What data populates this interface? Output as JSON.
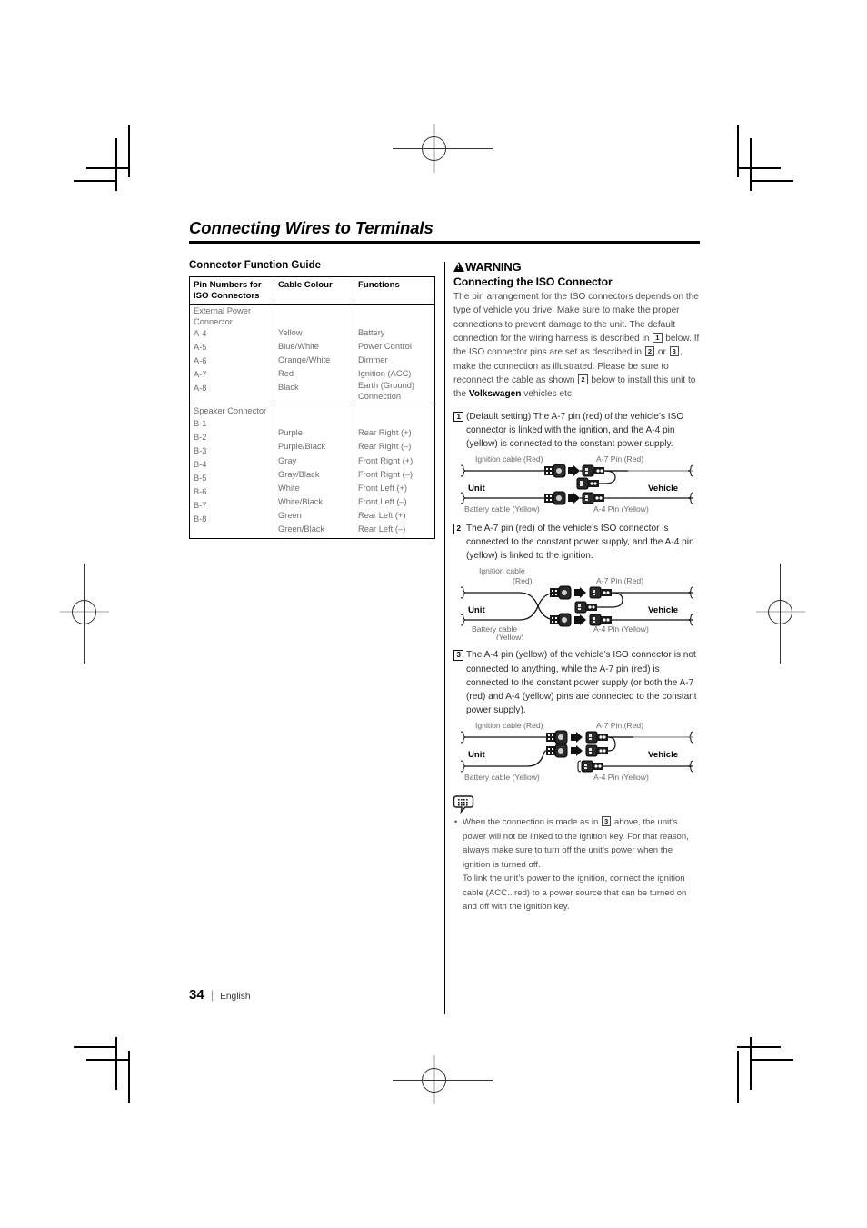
{
  "page": {
    "chapter_title": "Connecting Wires to Terminals",
    "page_number": "34",
    "separator": "|",
    "language": "English"
  },
  "left_column": {
    "section_heading": "Connector Function Guide",
    "table": {
      "headers": [
        "Pin Numbers for ISO Connectors",
        "Cable Colour",
        "Functions"
      ],
      "groups": [
        {
          "label": "External Power Connector",
          "rows": [
            {
              "pin": "A-4",
              "colour": "Yellow",
              "function": "Battery"
            },
            {
              "pin": "A-5",
              "colour": "Blue/White",
              "function": "Power Control"
            },
            {
              "pin": "A-6",
              "colour": "Orange/White",
              "function": "Dimmer"
            },
            {
              "pin": "A-7",
              "colour": "Red",
              "function": "Ignition (ACC)"
            },
            {
              "pin": "A-8",
              "colour": "Black",
              "function": "Earth (Ground) Connection"
            }
          ]
        },
        {
          "label": "Speaker Connector",
          "rows": [
            {
              "pin": "B-1",
              "colour": "Purple",
              "function": "Rear Right (+)"
            },
            {
              "pin": "B-2",
              "colour": "Purple/Black",
              "function": "Rear Right (–)"
            },
            {
              "pin": "B-3",
              "colour": "Gray",
              "function": "Front Right (+)"
            },
            {
              "pin": "B-4",
              "colour": "Gray/Black",
              "function": "Front Right (–)"
            },
            {
              "pin": "B-5",
              "colour": "White",
              "function": "Front Left (+)"
            },
            {
              "pin": "B-6",
              "colour": "White/Black",
              "function": "Front Left (–)"
            },
            {
              "pin": "B-7",
              "colour": "Green",
              "function": "Rear Left (+)"
            },
            {
              "pin": "B-8",
              "colour": "Green/Black",
              "function": "Rear Left (–)"
            }
          ]
        }
      ]
    }
  },
  "right_column": {
    "warning_label": "WARNING",
    "sub_heading": "Connecting the ISO Connector",
    "intro_part1": "The pin arrangement for the ISO connectors depends on the type of vehicle you drive. Make sure to make the proper connections to prevent damage to the unit. The default connection for the wiring harness is described in ",
    "intro_ref1": "1",
    "intro_part2": " below. If the ISO connector pins are set as described in ",
    "intro_ref2": "2",
    "intro_part3": " or ",
    "intro_ref3": "3",
    "intro_part4": ", make the connection as illustrated. Please be sure to reconnect the cable as shown ",
    "intro_ref4": "2",
    "intro_part5": " below to install this unit to the ",
    "intro_bold": "Volkswagen",
    "intro_part6": " vehicles etc.",
    "items": [
      {
        "number": "1",
        "text": "(Default setting) The A-7 pin (red) of the vehicle’s ISO connector is linked with the ignition, and the A-4 pin (yellow) is connected to the constant power supply."
      },
      {
        "number": "2",
        "text": "The A-7 pin (red) of the vehicle’s ISO connector is connected to the constant power supply, and the A-4 pin (yellow) is linked to the ignition."
      },
      {
        "number": "3",
        "text": "The A-4 pin (yellow) of the vehicle’s ISO connector is not connected to anything, while the A-7 pin (red) is connected to the constant power supply (or both the A-7 (red) and A-4 (yellow) pins are connected to the constant power supply)."
      }
    ],
    "diagrams": [
      {
        "id": "diagram-1",
        "top_left_label": "Ignition cable (Red)",
        "top_right_label": "A-7 Pin (Red)",
        "unit_label": "Unit",
        "vehicle_label": "Vehicle",
        "bottom_left_label": "Battery cable (Yellow)",
        "bottom_right_label": "A-4 Pin (Yellow)"
      },
      {
        "id": "diagram-2",
        "top_left_label_line1": "Ignition cable",
        "top_left_label_line2": "(Red)",
        "top_right_label": "A-7 Pin (Red)",
        "unit_label": "Unit",
        "vehicle_label": "Vehicle",
        "bottom_left_label_line1": "Battery cable",
        "bottom_left_label_line2": "(Yellow)",
        "bottom_right_label": "A-4 Pin (Yellow)"
      },
      {
        "id": "diagram-3",
        "top_left_label": "Ignition cable (Red)",
        "top_right_label": "A-7 Pin (Red)",
        "unit_label": "Unit",
        "vehicle_label": "Vehicle",
        "bottom_left_label": "Battery cable (Yellow)",
        "bottom_right_label": "A-4 Pin (Yellow)"
      }
    ],
    "note": {
      "bullet": "•",
      "para1_part1": "When the connection is made as in ",
      "para1_ref": "3",
      "para1_part2": " above, the unit’s power will not be linked to the ignition key. For that reason, always make sure to turn off the unit’s power when the ignition is turned off.",
      "para2": "To link the unit’s power to the ignition, connect the ignition cable (ACC...red) to a power source that can be turned on and off with the ignition key."
    }
  }
}
